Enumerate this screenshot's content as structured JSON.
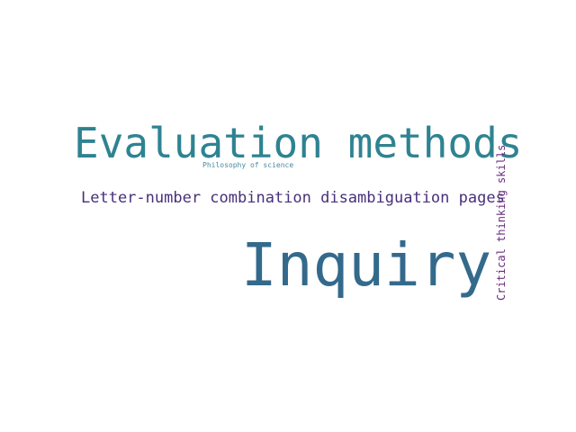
{
  "words": [
    {
      "text": "Evaluation methods",
      "color": "#2e8391"
    },
    {
      "text": "Philosophy of science",
      "color": "#4a8aa0"
    },
    {
      "text": "Letter-number combination disambiguation pages",
      "color": "#47307a"
    },
    {
      "text": "Inquiry",
      "color": "#336a8c"
    },
    {
      "text": "Critical thinking skills",
      "color": "#6a2c7e"
    }
  ]
}
